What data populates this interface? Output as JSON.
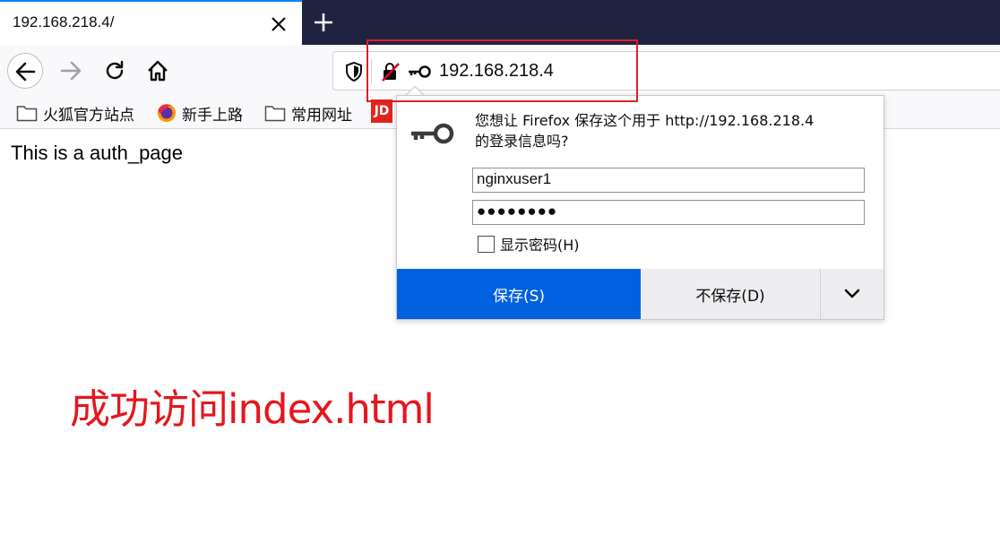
{
  "tab": {
    "title": "192.168.218.4/"
  },
  "urlbar": {
    "url": "192.168.218.4"
  },
  "bookmarks": [
    {
      "label": "火狐官方站点",
      "icon": "folder-icon"
    },
    {
      "label": "新手上路",
      "icon": "firefox-icon"
    },
    {
      "label": "常用网址",
      "icon": "folder-icon"
    },
    {
      "label": "JD",
      "icon": "jd-icon"
    }
  ],
  "page": {
    "text": "This is a auth_page",
    "annotation": "成功访问index.html"
  },
  "popup": {
    "message_line1": "您想让 Firefox 保存这个用于 http://192.168.218.4",
    "message_line2": "的登录信息吗?",
    "username": "nginxuser1",
    "password_masked": "●●●●●●●●",
    "show_password": "显示密码(H)",
    "save": "保存(S)",
    "dont_save": "不保存(D)"
  },
  "colors": {
    "accent": "#0060df",
    "annotation_red": "#e31e24",
    "tabstrip": "#202340"
  }
}
